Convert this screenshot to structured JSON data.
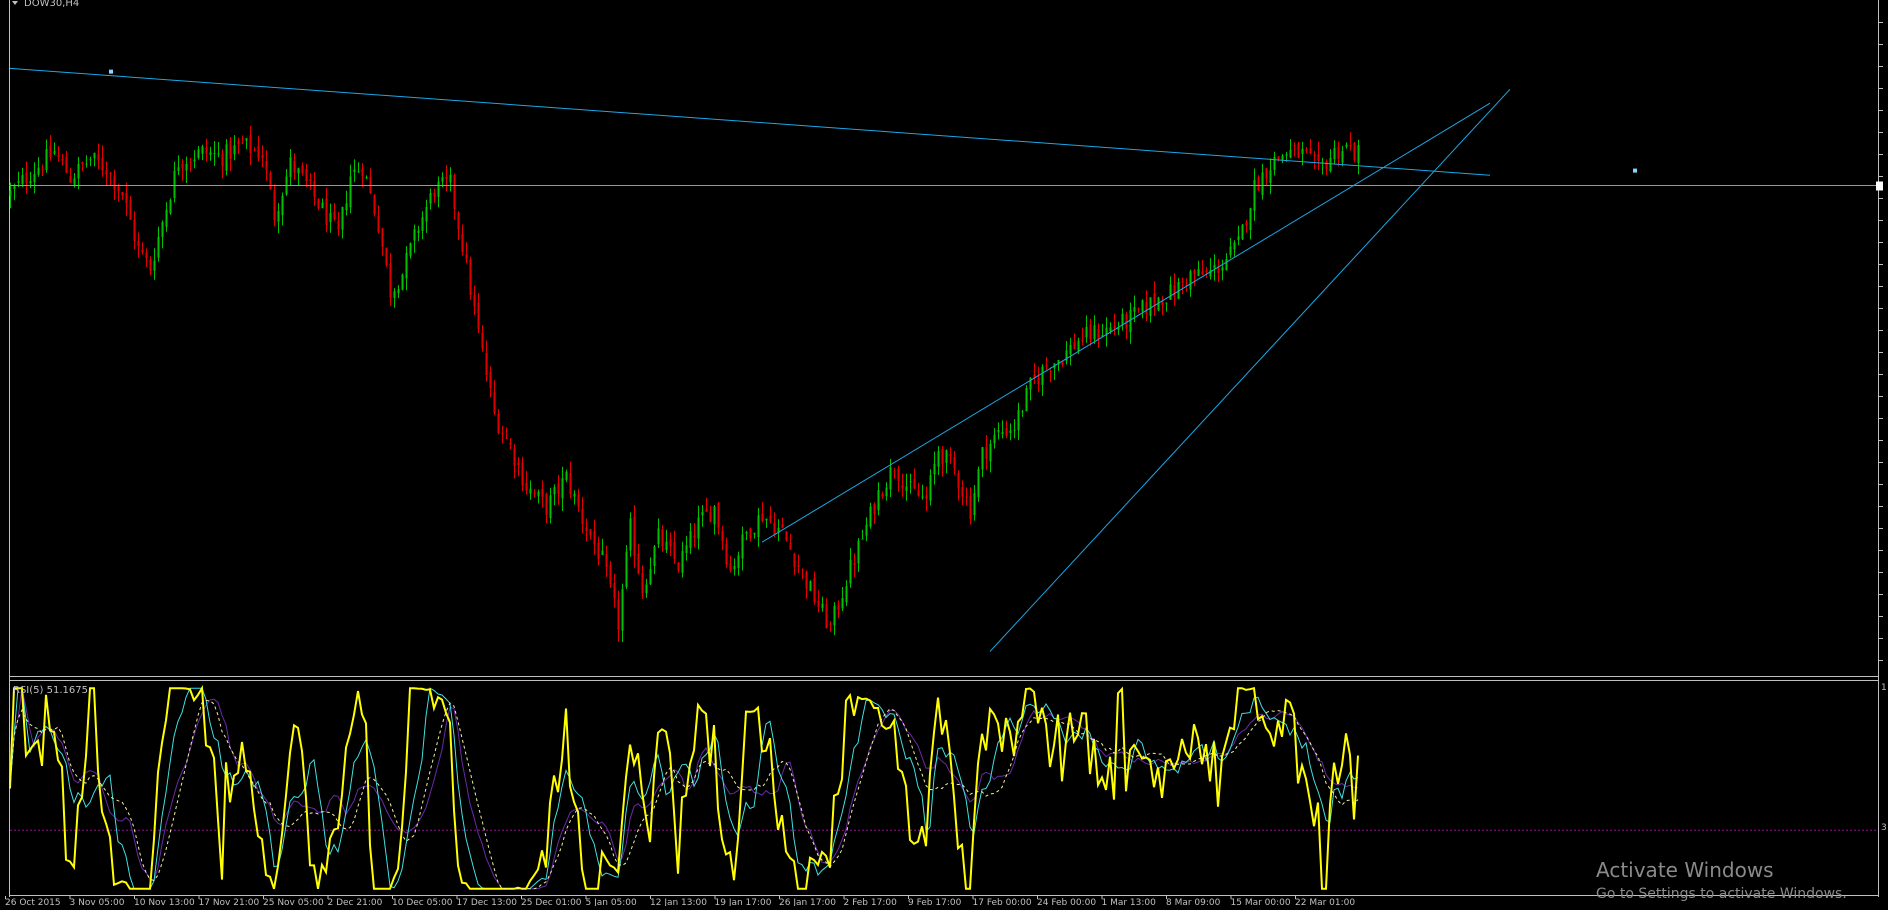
{
  "app": {
    "symbol_label": "DOW30,H4",
    "symbol_menu_icon": "triangle-down-icon"
  },
  "colors": {
    "background": "#000000",
    "border": "#c0c0c0",
    "bull_candle": "#00c000",
    "bear_candle": "#e00000",
    "trendline": "#1ea7e6",
    "rsi_main": "#ffff00",
    "rsi_cyan": "#40e0e0",
    "rsi_purple": "#6a2aa8",
    "level_line": "#8a1a8a"
  },
  "time_axis": {
    "labels": [
      "26 Oct 2015",
      "3 Nov 05:00",
      "10 Nov 13:00",
      "17 Nov 21:00",
      "25 Nov 05:00",
      "2 Dec 21:00",
      "10 Dec 05:00",
      "17 Dec 13:00",
      "25 Dec 01:00",
      "5 Jan 05:00",
      "12 Jan 13:00",
      "19 Jan 17:00",
      "26 Jan 17:00",
      "2 Feb 17:00",
      "9 Feb 17:00",
      "17 Feb 00:00",
      "24 Feb 00:00",
      "1 Mar 13:00",
      "8 Mar 09:00",
      "15 Mar 00:00",
      "22 Mar 01:00"
    ]
  },
  "indicator": {
    "label": "RSI(5) 51.1675",
    "right_tick_top": "1",
    "right_tick_level": "3"
  },
  "watermark": {
    "title": "Activate Windows",
    "subtitle": "Go to Settings to activate Windows."
  },
  "chart_data": {
    "type": "candlestick",
    "symbol": "DOW30",
    "timeframe": "H4",
    "close_path": [
      [
        0,
        17300
      ],
      [
        5,
        17390
      ],
      [
        11,
        17480
      ],
      [
        15,
        17370
      ],
      [
        20,
        17450
      ],
      [
        24,
        17410
      ],
      [
        28,
        17300
      ],
      [
        32,
        17060
      ],
      [
        35,
        16980
      ],
      [
        38,
        17180
      ],
      [
        42,
        17440
      ],
      [
        48,
        17480
      ],
      [
        53,
        17460
      ],
      [
        58,
        17510
      ],
      [
        63,
        17470
      ],
      [
        66,
        17210
      ],
      [
        70,
        17430
      ],
      [
        74,
        17340
      ],
      [
        78,
        17230
      ],
      [
        82,
        17120
      ],
      [
        85,
        17380
      ],
      [
        88,
        17420
      ],
      [
        92,
        17170
      ],
      [
        95,
        16880
      ],
      [
        98,
        16960
      ],
      [
        102,
        17160
      ],
      [
        106,
        17320
      ],
      [
        110,
        17340
      ],
      [
        113,
        17080
      ],
      [
        117,
        16700
      ],
      [
        121,
        16350
      ],
      [
        125,
        16210
      ],
      [
        129,
        16040
      ],
      [
        134,
        15950
      ],
      [
        139,
        16080
      ],
      [
        143,
        15900
      ],
      [
        148,
        15720
      ],
      [
        152,
        15450
      ],
      [
        155,
        15860
      ],
      [
        158,
        15600
      ],
      [
        162,
        15820
      ],
      [
        167,
        15700
      ],
      [
        172,
        15880
      ],
      [
        176,
        15950
      ],
      [
        180,
        15680
      ],
      [
        184,
        15840
      ],
      [
        188,
        15920
      ],
      [
        193,
        15840
      ],
      [
        197,
        15700
      ],
      [
        201,
        15560
      ],
      [
        205,
        15430
      ],
      [
        209,
        15640
      ],
      [
        213,
        15820
      ],
      [
        217,
        16010
      ],
      [
        221,
        16130
      ],
      [
        225,
        16020
      ],
      [
        229,
        15980
      ],
      [
        232,
        16200
      ],
      [
        236,
        16110
      ],
      [
        240,
        15940
      ],
      [
        243,
        16180
      ],
      [
        247,
        16270
      ],
      [
        251,
        16300
      ],
      [
        255,
        16470
      ],
      [
        259,
        16560
      ],
      [
        263,
        16600
      ],
      [
        267,
        16670
      ],
      [
        271,
        16700
      ],
      [
        275,
        16720
      ],
      [
        279,
        16750
      ],
      [
        283,
        16800
      ],
      [
        287,
        16850
      ],
      [
        291,
        16880
      ],
      [
        295,
        16950
      ],
      [
        299,
        16950
      ],
      [
        303,
        17000
      ],
      [
        307,
        17080
      ],
      [
        311,
        17330
      ],
      [
        315,
        17430
      ],
      [
        319,
        17480
      ],
      [
        323,
        17470
      ],
      [
        327,
        17400
      ],
      [
        331,
        17480
      ],
      [
        334,
        17500
      ],
      [
        337,
        17470
      ]
    ],
    "candle_count": 338,
    "price_range": [
      15250,
      18100
    ],
    "horizontal_line": 17340,
    "trendlines": [
      {
        "from": [
          0,
          17840
        ],
        "to": [
          370,
          17380
        ]
      },
      {
        "from": [
          188,
          15800
        ],
        "to": [
          370,
          17690
        ]
      },
      {
        "from": [
          245,
          15330
        ],
        "to": [
          375,
          17750
        ]
      }
    ],
    "indicator": {
      "name": "RSI",
      "period": 5,
      "last_value": 51.1675,
      "range": [
        0,
        100
      ],
      "level": 30
    }
  }
}
